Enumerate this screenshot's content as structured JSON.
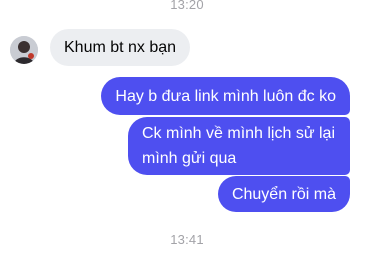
{
  "chat": {
    "timestamp_top": "13:20",
    "timestamp_bottom": "13:41",
    "incoming": [
      {
        "text": "Khum bt nx bạn"
      }
    ],
    "outgoing": [
      {
        "text": "Hay b đưa link mình luôn đc ko"
      },
      {
        "text": "Ck mình về mình lịch sử lại mình gửi qua"
      },
      {
        "text": "Chuyển rồi mà"
      }
    ]
  },
  "colors": {
    "outgoing_bubble": "#4e4ff0",
    "incoming_bubble": "#eceef1",
    "timestamp": "#a3a3a8"
  }
}
